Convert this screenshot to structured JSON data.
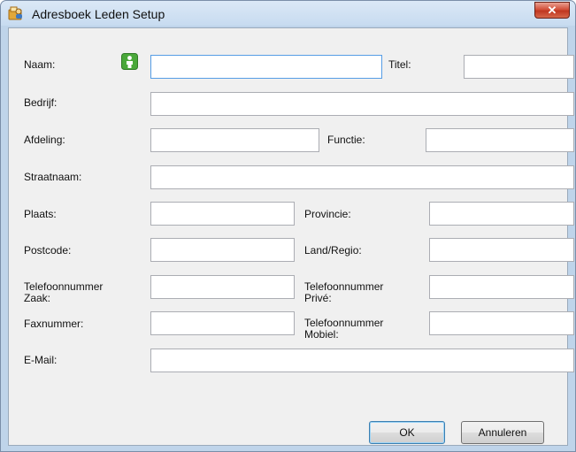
{
  "window": {
    "title": "Adresboek Leden Setup",
    "close_label": "✕"
  },
  "labels": {
    "naam": "Naam:",
    "titel": "Titel:",
    "bedrijf": "Bedrijf:",
    "afdeling": "Afdeling:",
    "functie": "Functie:",
    "straatnaam": "Straatnaam:",
    "plaats": "Plaats:",
    "provincie": "Provincie:",
    "postcode": "Postcode:",
    "land_regio": "Land/Regio:",
    "tel_zaak_1": "Telefoonnummer",
    "tel_zaak_2": "Zaak:",
    "tel_prive_1": "Telefoonnummer",
    "tel_prive_2": "Privé:",
    "faxnummer": "Faxnummer:",
    "tel_mobiel_1": "Telefoonnummer",
    "tel_mobiel_2": "Mobiel:",
    "email": "E-Mail:"
  },
  "fields": {
    "naam": "",
    "titel": "",
    "bedrijf": "",
    "afdeling": "",
    "functie": "",
    "straatnaam": "",
    "plaats": "",
    "provincie": "",
    "postcode": "",
    "land_regio": "",
    "tel_zaak": "",
    "tel_prive": "",
    "faxnummer": "",
    "tel_mobiel": "",
    "email": ""
  },
  "buttons": {
    "ok": "OK",
    "cancel": "Annuleren"
  },
  "icons": {
    "app": "address-book-icon",
    "person": "person-icon",
    "accent_green": "#4aa83a"
  }
}
